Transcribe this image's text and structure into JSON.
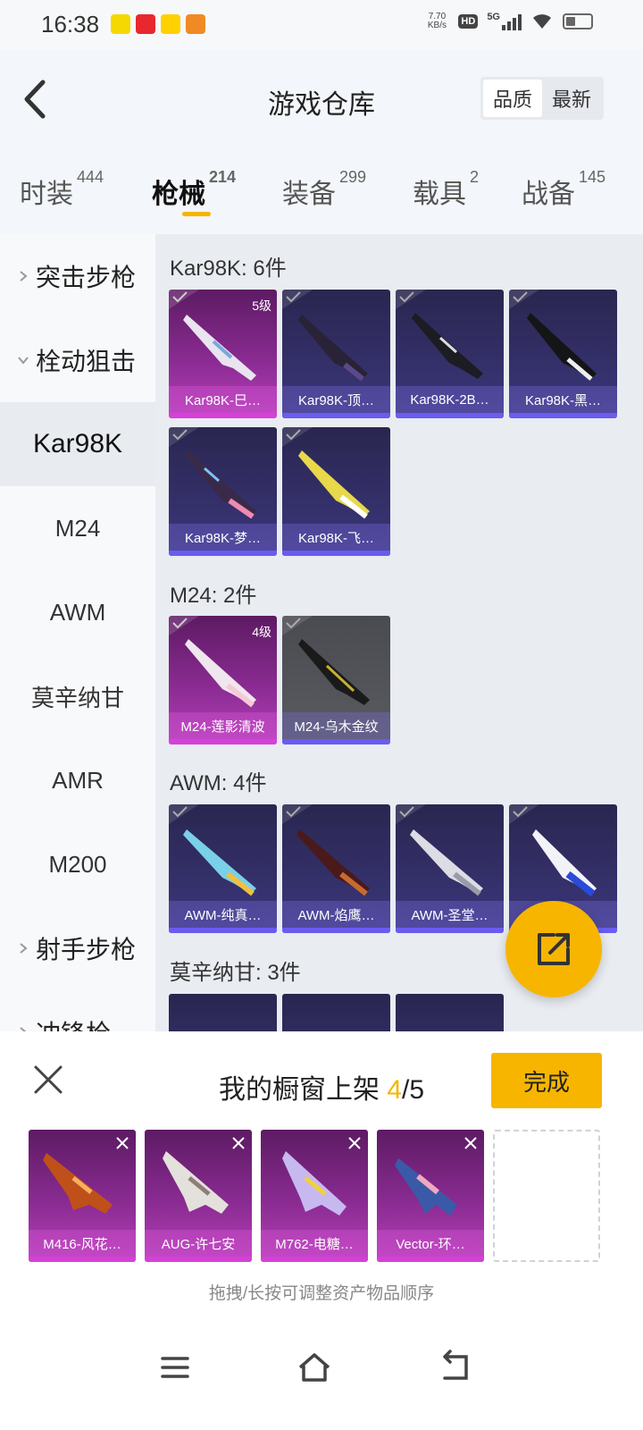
{
  "status_bar": {
    "time": "16:38",
    "net_speed_value": "7.70",
    "net_speed_unit": "KB/s",
    "hd": "HD",
    "network": "5G"
  },
  "header": {
    "title": "游戏仓库",
    "sort_quality": "品质",
    "sort_newest": "最新"
  },
  "tabs": [
    {
      "label": "时装",
      "count": "444"
    },
    {
      "label": "枪械",
      "count": "214"
    },
    {
      "label": "装备",
      "count": "299"
    },
    {
      "label": "载具",
      "count": "2"
    },
    {
      "label": "战备",
      "count": "145"
    }
  ],
  "sidebar": {
    "items": [
      {
        "label": "突击步枪"
      },
      {
        "label": "栓动狙击"
      },
      {
        "label": "Kar98K"
      },
      {
        "label": "M24"
      },
      {
        "label": "AWM"
      },
      {
        "label": "莫辛纳甘"
      },
      {
        "label": "AMR"
      },
      {
        "label": "M200"
      },
      {
        "label": "射手步枪"
      },
      {
        "label": "冲锋枪"
      }
    ]
  },
  "sections": [
    {
      "title": "Kar98K: 6件",
      "items": [
        {
          "label": "Kar98K-巳…",
          "level": "5级"
        },
        {
          "label": "Kar98K-顶…"
        },
        {
          "label": "Kar98K-2B…"
        },
        {
          "label": "Kar98K-黑…"
        },
        {
          "label": "Kar98K-梦…"
        },
        {
          "label": "Kar98K-飞…"
        }
      ]
    },
    {
      "title": "M24: 2件",
      "items": [
        {
          "label": "M24-莲影清波",
          "level": "4级"
        },
        {
          "label": "M24-乌木金纹"
        }
      ]
    },
    {
      "title": "AWM: 4件",
      "items": [
        {
          "label": "AWM-纯真…"
        },
        {
          "label": "AWM-焰鹰…"
        },
        {
          "label": "AWM-圣堂…"
        },
        {
          "label": "AWM-…"
        }
      ]
    },
    {
      "title": "莫辛纳甘: 3件",
      "items": []
    }
  ],
  "showcase": {
    "title_prefix": "我的橱窗上架 ",
    "count_current": "4",
    "count_total": "/5",
    "done_label": "完成",
    "slots": [
      {
        "label": "M416-风花…"
      },
      {
        "label": "AUG-许七安"
      },
      {
        "label": "M762-电糖…"
      },
      {
        "label": "Vector-环…"
      }
    ],
    "hint": "拖拽/长按可调整资产物品顺序"
  },
  "colors": {
    "accent": "#f7b500",
    "legendary_purple": "#b640b8",
    "epic_blue": "#6a5cf0"
  }
}
